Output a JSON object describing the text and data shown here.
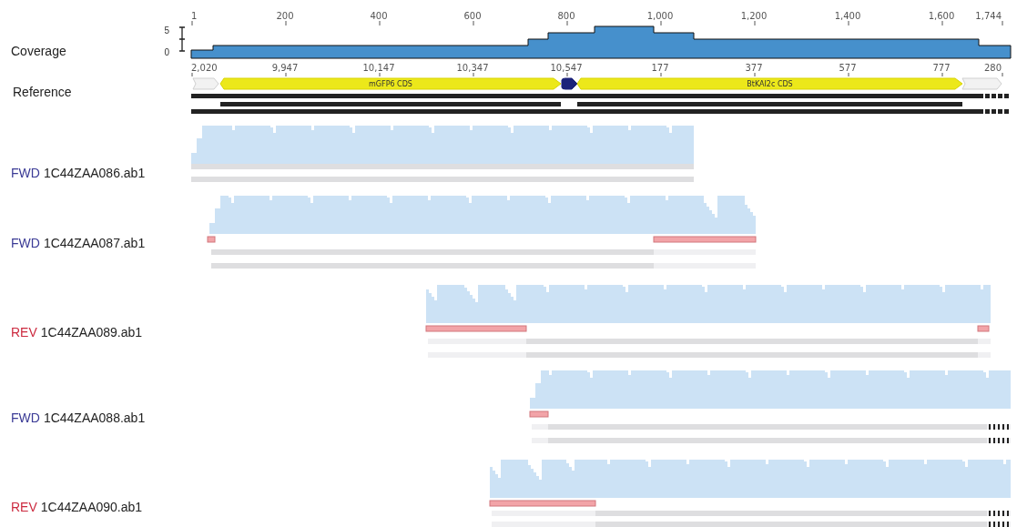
{
  "ruler": {
    "ticks": [
      "1",
      "200",
      "400",
      "600",
      "800",
      "1,000",
      "1,200",
      "1,400",
      "1,600",
      "1,744"
    ]
  },
  "coverage": {
    "label": "Coverage",
    "scale_max": "5",
    "scale_min": "0"
  },
  "reference": {
    "label": "Reference",
    "ticks": [
      "2,020",
      "9,947",
      "10,147",
      "10,347",
      "10,547",
      "177",
      "377",
      "577",
      "777",
      "280"
    ],
    "features": [
      {
        "kind": "region"
      },
      {
        "kind": "cds",
        "label": "mGFP6 CDS"
      },
      {
        "kind": "marker"
      },
      {
        "kind": "cds",
        "label": "BtKAI2c CDS"
      },
      {
        "kind": "region"
      }
    ]
  },
  "reads": [
    {
      "kind": "forward",
      "direction": "FWD",
      "name": "1C44ZAA086.ab1"
    },
    {
      "kind": "forward",
      "direction": "FWD",
      "name": "1C44ZAA087.ab1"
    },
    {
      "kind": "reverse",
      "direction": "REV",
      "name": "1C44ZAA089.ab1"
    },
    {
      "kind": "forward",
      "direction": "FWD",
      "name": "1C44ZAA088.ab1"
    },
    {
      "kind": "reverse",
      "direction": "REV",
      "name": "1C44ZAA090.ab1"
    }
  ]
}
